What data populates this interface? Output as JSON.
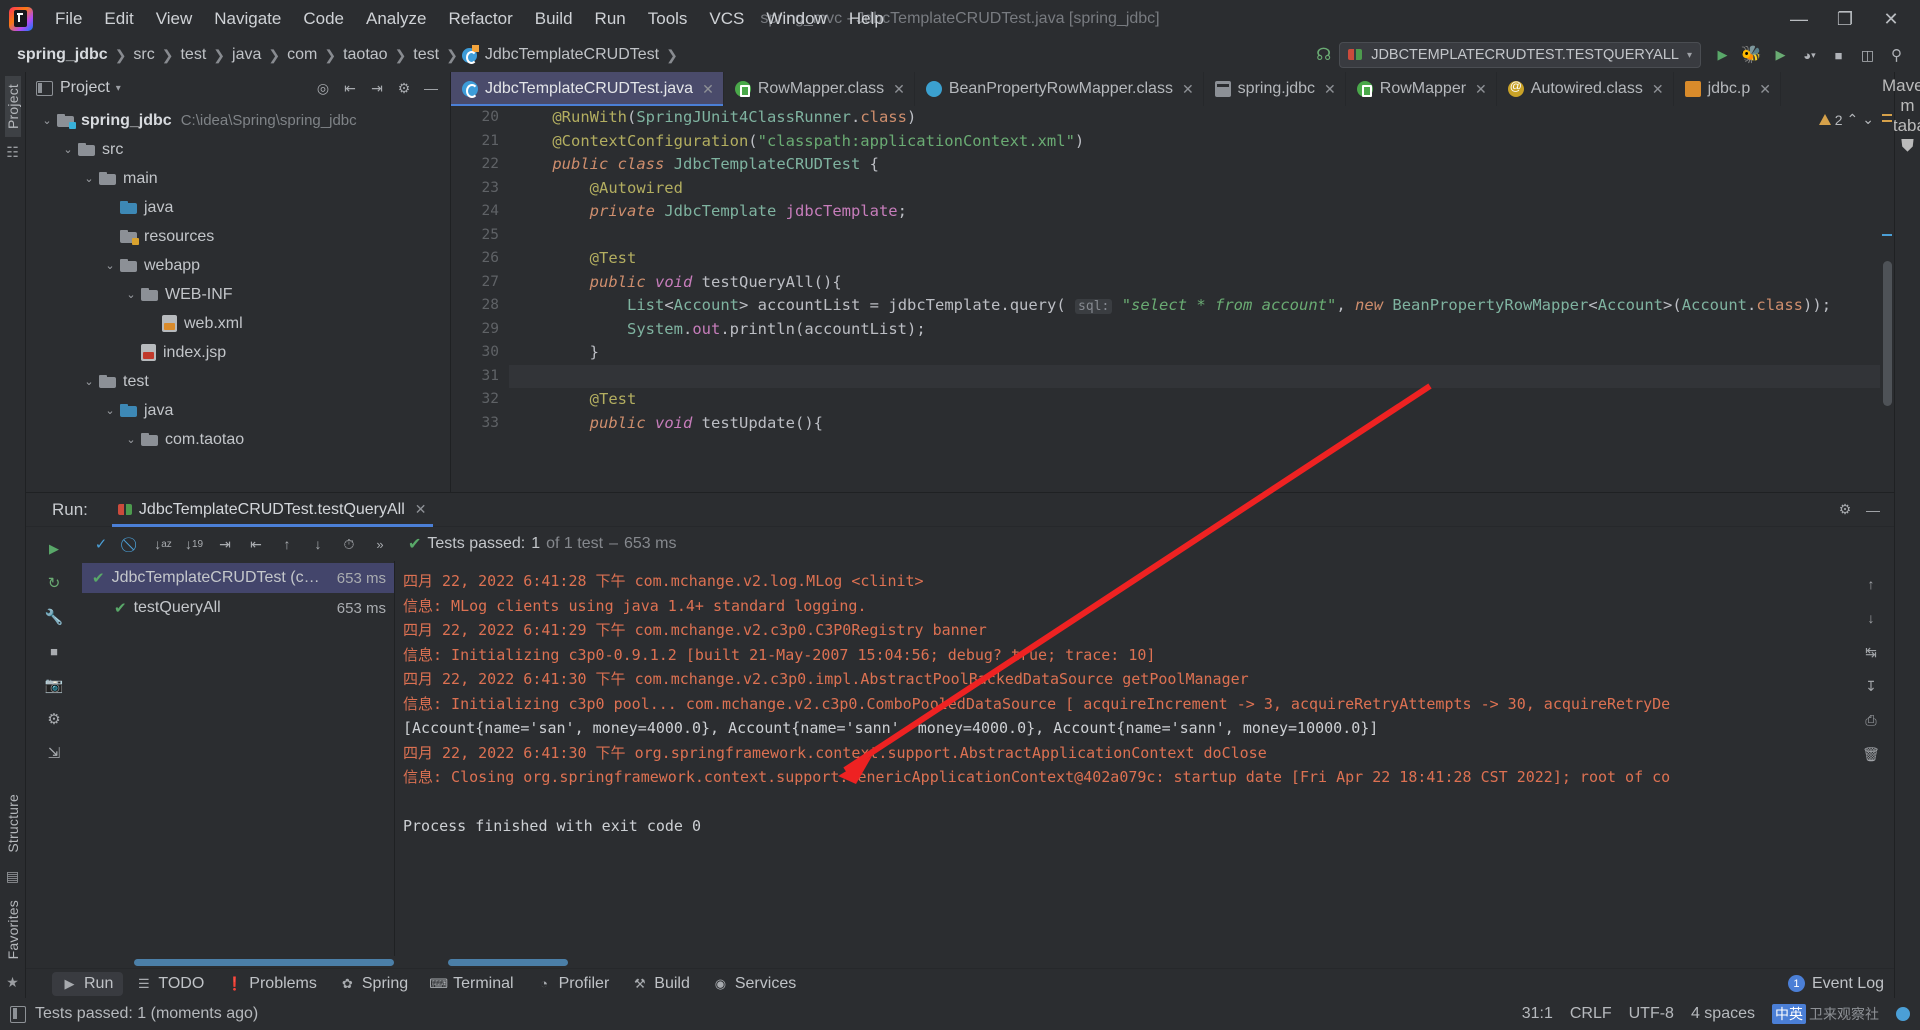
{
  "window": {
    "title": "spring_mvc - JdbcTemplateCRUDTest.java [spring_jdbc]"
  },
  "menubar": {
    "items": [
      "File",
      "Edit",
      "View",
      "Navigate",
      "Code",
      "Analyze",
      "Refactor",
      "Build",
      "Run",
      "Tools",
      "VCS",
      "Window",
      "Help"
    ],
    "controls": {
      "minimize": "—",
      "maximize": "❐",
      "close": "✕"
    }
  },
  "breadcrumb": {
    "items": [
      "spring_jdbc",
      "src",
      "test",
      "java",
      "com",
      "taotao",
      "test",
      "JdbcTemplateCRUDTest"
    ],
    "separator": "❯"
  },
  "toolbar": {
    "run_config": "JDBCTEMPLATECRUDTEST.TESTQUERYALL",
    "caret": "▾",
    "build_icon": "hammer-icon",
    "run_icon": "▶",
    "debug_icon": "debug-icon",
    "coverage_icon": "coverage-icon",
    "profile_icon": "profile-icon",
    "stop_icon": "■",
    "layout_icon": "layout-icon",
    "search_icon": "⚲"
  },
  "left_rail": {
    "items": [
      "Project",
      "Structure",
      "Favorites"
    ],
    "selected": "Project"
  },
  "right_rail": {
    "items": [
      "Maven",
      "Database"
    ]
  },
  "project_panel": {
    "title": "Project",
    "caret": "▾",
    "buttons": [
      "target-icon",
      "collapse-icon",
      "expand-icon",
      "gear-icon",
      "minimize-icon"
    ],
    "tree": [
      {
        "depth": 0,
        "arrow": "⌄",
        "icon": "module-folder",
        "label": "spring_jdbc",
        "bold": true,
        "path": "C:\\idea\\Spring\\spring_jdbc"
      },
      {
        "depth": 1,
        "arrow": "⌄",
        "icon": "folder",
        "label": "src",
        "bold": false,
        "path": ""
      },
      {
        "depth": 2,
        "arrow": "⌄",
        "icon": "folder",
        "label": "main",
        "bold": false,
        "path": ""
      },
      {
        "depth": 3,
        "arrow": "",
        "icon": "source-folder",
        "label": "java",
        "bold": false,
        "path": ""
      },
      {
        "depth": 3,
        "arrow": "",
        "icon": "resource-folder",
        "label": "resources",
        "bold": false,
        "path": ""
      },
      {
        "depth": 3,
        "arrow": "⌄",
        "icon": "folder",
        "label": "webapp",
        "bold": false,
        "path": ""
      },
      {
        "depth": 4,
        "arrow": "⌄",
        "icon": "folder",
        "label": "WEB-INF",
        "bold": false,
        "path": ""
      },
      {
        "depth": 5,
        "arrow": "",
        "icon": "xml-file",
        "label": "web.xml",
        "bold": false,
        "path": ""
      },
      {
        "depth": 4,
        "arrow": "",
        "icon": "jsp-file",
        "label": "index.jsp",
        "bold": false,
        "path": ""
      },
      {
        "depth": 2,
        "arrow": "⌄",
        "icon": "folder",
        "label": "test",
        "bold": false,
        "path": ""
      },
      {
        "depth": 3,
        "arrow": "⌄",
        "icon": "source-folder",
        "label": "java",
        "bold": false,
        "path": ""
      },
      {
        "depth": 4,
        "arrow": "⌄",
        "icon": "folder",
        "label": "com.taotao",
        "bold": false,
        "path": ""
      }
    ]
  },
  "editor": {
    "tabs": [
      {
        "label": "JdbcTemplateCRUDTest.java",
        "icon": "java-test-class-icon",
        "active": true,
        "close": "✕"
      },
      {
        "label": "RowMapper.class",
        "icon": "interface-icon",
        "active": false,
        "close": "✕"
      },
      {
        "label": "BeanPropertyRowMapper.class",
        "icon": "class-icon",
        "active": false,
        "close": "✕"
      },
      {
        "label": "spring.jdbc",
        "icon": "package-icon",
        "active": false,
        "close": "✕"
      },
      {
        "label": "RowMapper",
        "icon": "interface-icon",
        "active": false,
        "close": "✕"
      },
      {
        "label": "Autowired.class",
        "icon": "annotation-icon",
        "active": false,
        "close": "✕"
      },
      {
        "label": "jdbc.p",
        "icon": "properties-icon",
        "active": false,
        "close": "✕"
      }
    ],
    "warning_count": "2",
    "warning_up": "⌃",
    "warning_down": "⌄",
    "lines": [
      {
        "n": "20",
        "gutter": "",
        "html": "    <span class='ann2'>@RunWith</span><span class='id'>(</span><span class='typ'>SpringJUnit4ClassRunner</span><span class='id'>.</span><span class='kw'>class</span><span class='id'>)</span>"
      },
      {
        "n": "21",
        "gutter": "spring-bean",
        "html": "    <span class='ann2'>@ContextConfiguration</span><span class='id'>(</span><span class='str'>\"classpath:applicationContext.xml\"</span><span class='id'>)</span>"
      },
      {
        "n": "22",
        "gutter": "run-test",
        "html": "    <span class='kw ital'>public</span> <span class='kw ital'>class</span> <span class='typ'>JdbcTemplateCRUDTest</span> <span class='id'>{</span>"
      },
      {
        "n": "23",
        "gutter": "",
        "html": "        <span class='ann2'>@Autowired</span>"
      },
      {
        "n": "24",
        "gutter": "bean-inject",
        "html": "        <span class='kw ital'>private</span> <span class='typ'>JdbcTemplate</span> <span class='fld2'>jdbcTemplate</span><span class='id'>;</span>"
      },
      {
        "n": "25",
        "gutter": "",
        "html": ""
      },
      {
        "n": "26",
        "gutter": "",
        "html": "        <span class='ann2'>@Test</span>"
      },
      {
        "n": "27",
        "gutter": "run-test",
        "html": "        <span class='kw ital'>public</span> <span class='kw2 ital'>void</span> <span class='id'>testQueryAll</span><span class='id'>(){</span>"
      },
      {
        "n": "28",
        "gutter": "",
        "html": "            <span class='typ'>List</span><span class='id'>&lt;</span><span class='typ'>Account</span><span class='id'>&gt;</span> <span class='id'>accountList</span> <span class='id'>=</span> <span class='id'>jdbcTemplate</span><span class='id'>.</span><span class='id'>query</span><span class='id'>(</span> <span class='hint'>sql:</span> <span class='str ital'>\"select * from account\"</span><span class='id'>,</span> <span class='kw ital'>new</span> <span class='typ'>BeanPropertyRowMapper</span><span class='id'>&lt;</span><span class='typ'>Account</span><span class='id'>&gt;(</span><span class='typ'>Account</span><span class='id'>.</span><span class='kw'>class</span><span class='id'>));</span>"
      },
      {
        "n": "29",
        "gutter": "",
        "html": "            <span class='typ'>System</span><span class='id'>.</span><span class='fld2'>out</span><span class='id'>.</span><span class='id'>println</span><span class='id'>(</span><span class='id'>accountList</span><span class='id'>);</span>"
      },
      {
        "n": "30",
        "gutter": "",
        "html": "        <span class='id'>}</span>"
      },
      {
        "n": "31",
        "gutter": "",
        "html": "",
        "highlight": true
      },
      {
        "n": "32",
        "gutter": "",
        "html": "        <span class='ann2'>@Test</span>"
      },
      {
        "n": "33",
        "gutter": "run-test",
        "html": "        <span class='kw ital'>public</span> <span class='kw2 ital'>void</span> <span class='id'>testUpdate</span><span class='id'>(){</span>"
      }
    ]
  },
  "run_panel": {
    "label": "Run:",
    "tab_title": "JdbcTemplateCRUDTest.testQueryAll",
    "tab_close": "✕",
    "head_buttons": [
      "gear-icon",
      "minimize-icon"
    ],
    "toolbar_icons": [
      "run-icon",
      "rerun-icon",
      "wrench-icon",
      "stop-icon",
      "camera-icon",
      "settings-icon",
      "export-icon"
    ],
    "test_toolbar": [
      "show-passed-icon",
      "ignore-icon",
      "sort-alpha-icon",
      "sort-duration-icon",
      "expand-all-icon",
      "collapse-all-icon",
      "prev-icon",
      "next-icon",
      "history-icon",
      "more-icon"
    ],
    "status": {
      "prefix": "Tests passed:",
      "count": "1",
      "suffix": "of 1 test",
      "dash": "–",
      "time": "653 ms",
      "check": "✔"
    },
    "tests": [
      {
        "name": "JdbcTemplateCRUDTest (com.taota",
        "time": "653 ms",
        "selected": true,
        "check": "✔"
      },
      {
        "name": "testQueryAll",
        "time": "653 ms",
        "selected": false,
        "check": "✔"
      }
    ],
    "console": [
      {
        "text": "四月 22, 2022 6:41:28 下午 com.mchange.v2.log.MLog <clinit>",
        "white": false
      },
      {
        "text": "信息: MLog clients using java 1.4+ standard logging.",
        "white": false
      },
      {
        "text": "四月 22, 2022 6:41:29 下午 com.mchange.v2.c3p0.C3P0Registry banner",
        "white": false
      },
      {
        "text": "信息: Initializing c3p0-0.9.1.2 [built 21-May-2007 15:04:56; debug? true; trace: 10]",
        "white": false
      },
      {
        "text": "四月 22, 2022 6:41:30 下午 com.mchange.v2.c3p0.impl.AbstractPoolBackedDataSource getPoolManager",
        "white": false
      },
      {
        "text": "信息: Initializing c3p0 pool... com.mchange.v2.c3p0.ComboPooledDataSource [ acquireIncrement -> 3, acquireRetryAttempts -> 30, acquireRetryDe",
        "white": false
      },
      {
        "text": "[Account{name='san', money=4000.0}, Account{name='sann', money=4000.0}, Account{name='sann', money=10000.0}]",
        "white": true
      },
      {
        "text": "四月 22, 2022 6:41:30 下午 org.springframework.context.support.AbstractApplicationContext doClose",
        "white": false
      },
      {
        "text": "信息: Closing org.springframework.context.support.GenericApplicationContext@402a079c: startup date [Fri Apr 22 18:41:28 CST 2022]; root of co",
        "white": false
      },
      {
        "text": "",
        "white": true
      },
      {
        "text": "Process finished with exit code 0",
        "white": true
      }
    ],
    "console_rail": [
      "scroll-up-icon",
      "scroll-down-icon",
      "soft-wrap-icon",
      "scroll-end-icon",
      "print-icon",
      "delete-icon"
    ]
  },
  "toolwindow_bar": {
    "items": [
      {
        "label": "Run",
        "icon": "▶",
        "active": true
      },
      {
        "label": "TODO",
        "icon": "☰",
        "active": false
      },
      {
        "label": "Problems",
        "icon": "❗",
        "active": false
      },
      {
        "label": "Spring",
        "icon": "✿",
        "active": false
      },
      {
        "label": "Terminal",
        "icon": "⌨",
        "active": false
      },
      {
        "label": "Profiler",
        "icon": "◔",
        "active": false
      },
      {
        "label": "Build",
        "icon": "⚒",
        "active": false
      },
      {
        "label": "Services",
        "icon": "◉",
        "active": false
      }
    ],
    "event_log": {
      "label": "Event Log",
      "count": "1"
    }
  },
  "statusbar": {
    "message": "Tests passed: 1 (moments ago)",
    "caret": "31:1",
    "line_sep": "CRLF",
    "encoding": "UTF-8",
    "indent": "4 spaces",
    "ime": "中英",
    "watermark": "卫来观察社"
  },
  "colors": {
    "accent": "#4b7fd6",
    "success": "#59a869",
    "console": "#dd7152",
    "annotation_arrow": "#ee2222"
  }
}
